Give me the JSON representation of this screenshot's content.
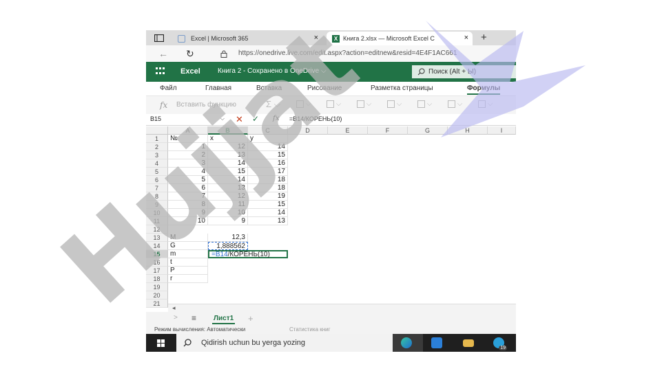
{
  "browser": {
    "tabs": [
      {
        "label": "Excel | Microsoft 365",
        "active": false
      },
      {
        "label": "Книга 2.xlsx — Microsoft Excel C",
        "active": true
      }
    ],
    "new_tab": "+",
    "close": "×",
    "url": "https://onedrive.live.com/edit.aspx?action=editnew&resid=4E4F1AC661"
  },
  "excel_header": {
    "app_name": "Excel",
    "document": "Книга 2 - Сохранено в OneDrive ⌵",
    "search_placeholder": "Поиск (Alt + Ы)"
  },
  "ribbon": {
    "tabs": [
      "Файл",
      "Главная",
      "Вставка",
      "Рисование",
      "Разметка страницы",
      "Формулы"
    ],
    "active_tab": "Формулы",
    "insert_function": "Вставить функцию"
  },
  "formula_bar": {
    "name_box": "B15",
    "fx": "fx",
    "formula": "=B14/КОРЕНЬ(10)"
  },
  "grid": {
    "columns": [
      "A",
      "B",
      "C",
      "D",
      "E",
      "F",
      "G",
      "H",
      "I"
    ],
    "selected_column": "B",
    "rows": [
      "1",
      "2",
      "3",
      "4",
      "5",
      "6",
      "7",
      "8",
      "9",
      "10",
      "11",
      "12",
      "13",
      "14",
      "15",
      "16",
      "17",
      "18",
      "19",
      "20",
      "21"
    ],
    "selected_row": "15",
    "header_row": {
      "a": "№",
      "b": "x",
      "c": "y"
    },
    "data": [
      {
        "n": "1",
        "x": "12",
        "y": "14"
      },
      {
        "n": "2",
        "x": "13",
        "y": "15"
      },
      {
        "n": "3",
        "x": "14",
        "y": "16"
      },
      {
        "n": "4",
        "x": "15",
        "y": "17"
      },
      {
        "n": "5",
        "x": "14",
        "y": "18"
      },
      {
        "n": "6",
        "x": "13",
        "y": "18"
      },
      {
        "n": "7",
        "x": "12",
        "y": "19"
      },
      {
        "n": "8",
        "x": "11",
        "y": "15"
      },
      {
        "n": "9",
        "x": "10",
        "y": "14"
      },
      {
        "n": "10",
        "x": "9",
        "y": "13"
      }
    ],
    "stats": {
      "m_label": "M",
      "m_value": "12,3",
      "g_label": "G",
      "g_value": "1,888562",
      "sm_label": "m",
      "sm_formula_ref": "=B14",
      "sm_formula_rest": "/КОРЕНЬ(10)",
      "t_label": "t",
      "p_label": "P",
      "r_label": "r"
    }
  },
  "sheet_tabs": {
    "active": "Лист1",
    "add": "+",
    "menu": "≡"
  },
  "status_bar": {
    "calc_mode": "Режим вычисления: Автоматически",
    "stats": "Статистика книг"
  },
  "taskbar": {
    "search_placeholder": "Qidirish uchun bu yerga yozing",
    "badge": "19"
  },
  "watermark": {
    "text": "Hujjat"
  },
  "colors": {
    "excel_green": "#217346",
    "watermark_gray": "#c8c8c8",
    "watermark_purple": "#b8b8f0",
    "ref_blue": "#2f6fd1"
  }
}
